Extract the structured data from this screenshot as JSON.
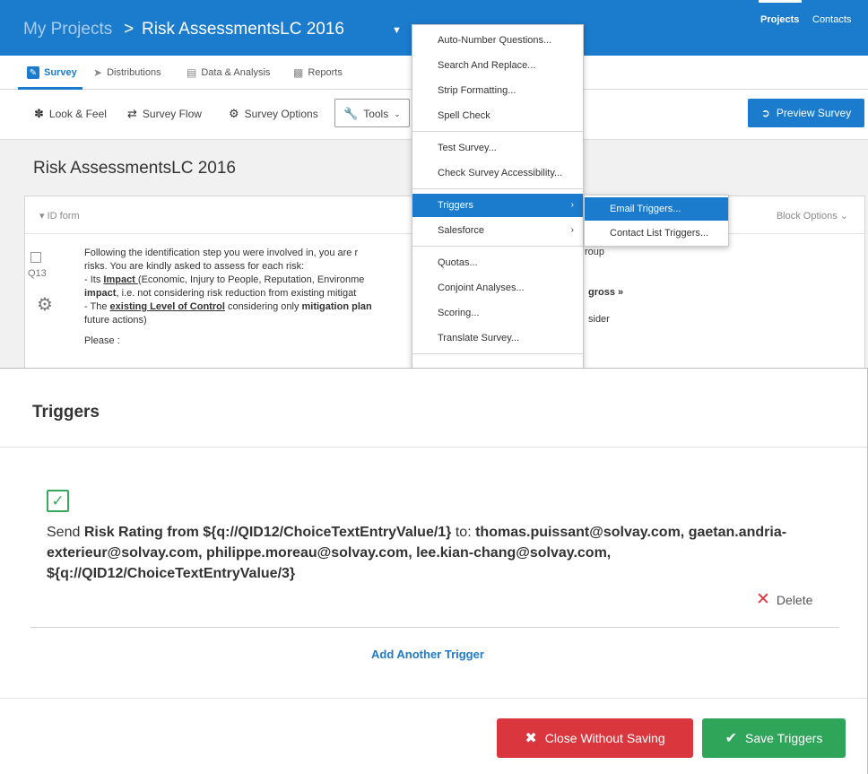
{
  "header": {
    "breadcrumb_root": "My Projects",
    "breadcrumb_sep": ">",
    "survey_name": "Risk AssessmentsLC 2016",
    "nav_projects": "Projects",
    "nav_contacts": "Contacts"
  },
  "tabs": [
    {
      "label": "Survey",
      "active": true
    },
    {
      "label": "Distributions"
    },
    {
      "label": "Data & Analysis"
    },
    {
      "label": "Reports"
    }
  ],
  "toolbar": {
    "look_feel": "Look & Feel",
    "survey_flow": "Survey Flow",
    "survey_options": "Survey Options",
    "tools": "Tools",
    "preview": "Preview Survey"
  },
  "survey": {
    "title": "Risk AssessmentsLC 2016",
    "block_name": "ID form",
    "block_options": "Block Options",
    "question_number": "Q13",
    "q_line1": "Following the identification step you were involved in, you are r",
    "q_line2": "risks. You are kindly asked to assess for each risk:",
    "q_line3a": "- Its ",
    "q_line3_impact": "Impact ",
    "q_line3b": "(Economic, Injury to People, Reputation, Environme",
    "q_line4_bold": "impact",
    "q_line4b": ", i.e. not considering  risk reduction from existing mitigat",
    "q_line5a": "- The ",
    "q_line5_loc": "existing Level of Control",
    "q_line5b": " considering only ",
    "q_line5_bold": "mitigation plan",
    "q_line6": "future actions)",
    "q_line7": "Please :",
    "tail_roup": "roup",
    "tail_gross": "gross »",
    "tail_sider": "sider"
  },
  "menu": {
    "items": [
      "Auto-Number Questions...",
      "Search And Replace...",
      "Strip Formatting...",
      "Spell Check",
      "Test Survey...",
      "Check Survey Accessibility...",
      "Triggers",
      "Salesforce",
      "Quotas...",
      "Conjoint Analyses...",
      "Scoring...",
      "Translate Survey..."
    ],
    "submenu": [
      "Email Triggers...",
      "Contact List Triggers..."
    ]
  },
  "modal": {
    "title": "Triggers",
    "send": "Send ",
    "subject": "Risk Rating from ${q://QID12/ChoiceTextEntryValue/1}",
    "to": " to: ",
    "recipients": "thomas.puissant@solvay.com, gaetan.andria-exterieur@solvay.com, philippe.moreau@solvay.com, lee.kian-chang@solvay.com, ${q://QID12/ChoiceTextEntryValue/3}",
    "delete": "Delete",
    "add_another": "Add Another Trigger",
    "close_without_saving": "Close Without Saving",
    "save_triggers": "Save Triggers"
  },
  "colors": {
    "brand_blue": "#1b7bcc",
    "danger_red": "#d9363e",
    "success_green": "#2fa55a"
  }
}
